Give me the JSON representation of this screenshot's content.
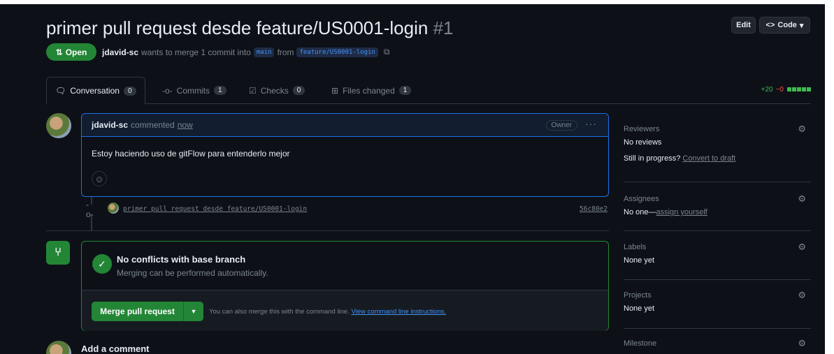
{
  "pr": {
    "title": "primer pull request desde feature/US0001-login",
    "number": "#1",
    "status": "Open",
    "author": "jdavid-sc",
    "merge_text": "wants to merge 1 commit into",
    "base_branch": "main",
    "from_text": "from",
    "head_branch": "feature/US0001-login"
  },
  "header": {
    "edit_label": "Edit",
    "code_label": "Code"
  },
  "tabs": [
    {
      "label": "Conversation",
      "count": "0"
    },
    {
      "label": "Commits",
      "count": "1"
    },
    {
      "label": "Checks",
      "count": "0"
    },
    {
      "label": "Files changed",
      "count": "1"
    }
  ],
  "diffstat": {
    "additions": "+20",
    "deletions": "−0"
  },
  "comment": {
    "author": "jdavid-sc",
    "action": "commented",
    "time": "now",
    "badge": "Owner",
    "body": "Estoy haciendo uso de gitFlow para entenderlo mejor"
  },
  "commit": {
    "message": "primer pull request desde feature/US0001-login",
    "sha": "56c80e2"
  },
  "merge": {
    "title": "No conflicts with base branch",
    "subtitle": "Merging can be performed automatically.",
    "button_label": "Merge pull request",
    "hint": "You can also merge this with the command line.",
    "hint_link": "View command line instructions."
  },
  "add_comment": {
    "label": "Add a comment"
  },
  "sidebar": {
    "reviewers": {
      "label": "Reviewers",
      "value": "No reviews",
      "progress_label": "Still in progress?",
      "progress_link": "Convert to draft"
    },
    "assignees": {
      "label": "Assignees",
      "value": "No one—",
      "link": "assign yourself"
    },
    "labels": {
      "label": "Labels",
      "value": "None yet"
    },
    "projects": {
      "label": "Projects",
      "value": "None yet"
    },
    "milestone": {
      "label": "Milestone"
    }
  },
  "colors": {
    "accent": "#238636",
    "link": "#4493f8",
    "background": "#0d1117"
  }
}
